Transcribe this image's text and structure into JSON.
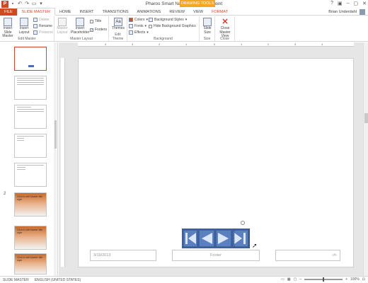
{
  "app": {
    "title": "Pharos Smart Navigator - PowerPoint",
    "context_label": "DRAWING TOOLS",
    "user_name": "Brian Underdahl"
  },
  "tabs": [
    "FILE",
    "SLIDE MASTER",
    "HOME",
    "INSERT",
    "TRANSITIONS",
    "ANIMATIONS",
    "REVIEW",
    "VIEW",
    "FORMAT"
  ],
  "ribbon": {
    "edit_master": {
      "label": "Edit Master",
      "insert_slide_master": "Insert Slide Master",
      "insert_layout": "Insert Layout",
      "delete": "Delete",
      "rename": "Rename",
      "preserve": "Preserve"
    },
    "master_layout": {
      "label": "Master Layout",
      "master_layout_btn": "Master Layout",
      "insert_placeholder": "Insert Placeholder",
      "title": "Title",
      "footers": "Footers"
    },
    "edit_theme": {
      "label": "Edit Theme",
      "themes": "Themes"
    },
    "background": {
      "label": "Background",
      "colors": "Colors",
      "fonts": "Fonts",
      "effects": "Effects",
      "background_styles": "Background Styles",
      "hide_background_graphics": "Hide Background Graphics"
    },
    "size": {
      "label": "Size",
      "slide_size": "Slide Size"
    },
    "close": {
      "label": "Close",
      "close_master_view": "Close Master View"
    }
  },
  "thumbnails": {
    "slide_number": "2",
    "orange_title_1": "Click to edit Master title style",
    "orange_title_2": "Click to edit Master title style",
    "orange_title_3": "Click to edit Master title style"
  },
  "slide": {
    "date": "3/19/2013",
    "footer": "Footer",
    "page_number": "‹#›"
  },
  "ruler": {
    "marks": [
      "4",
      "3",
      "2",
      "1",
      "0",
      "1",
      "2",
      "3",
      "4"
    ]
  },
  "status": {
    "view": "SLIDE MASTER",
    "language": "ENGLISH (UNITED STATES)",
    "zoom": "100%"
  },
  "colors": {
    "accent": "#d24726",
    "nav_button": "#4a6fb0"
  }
}
